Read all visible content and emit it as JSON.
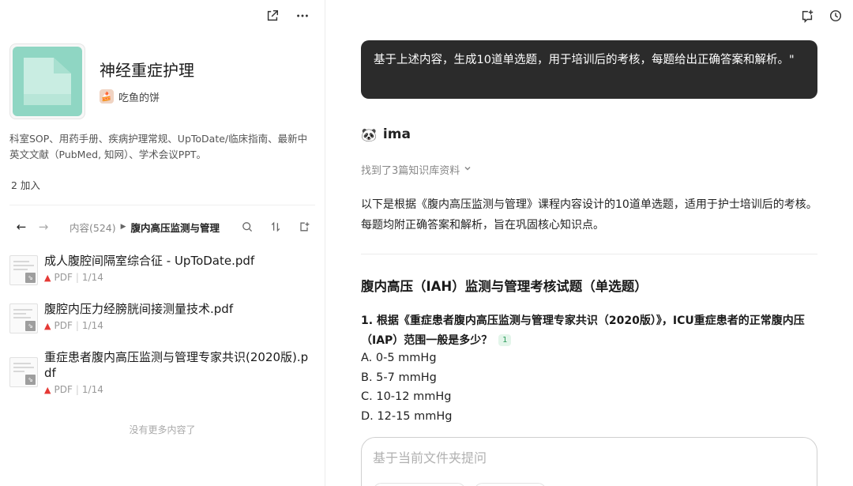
{
  "left_panel": {
    "knowledge_base": {
      "title": "神经重症护理",
      "author": "吃鱼的饼",
      "description": "科室SOP、用药手册、疾病护理常规、UpToDate/临床指南、最新中英文文献（PubMed, 知网）、学术会议PPT。",
      "joined": "2 加入"
    },
    "breadcrumb": {
      "root": "内容(524)",
      "current": "腹内高压监测与管理"
    },
    "files": [
      {
        "name": "成人腹腔间隔室综合征 - UpToDate.pdf",
        "type": "PDF",
        "pages": "1/14"
      },
      {
        "name": "腹腔内压力经膀胱间接测量技术.pdf",
        "type": "PDF",
        "pages": "1/14"
      },
      {
        "name": "重症患者腹内高压监测与管理专家共识(2020版).pdf",
        "type": "PDF",
        "pages": "1/14"
      }
    ],
    "no_more": "没有更多内容了"
  },
  "right_panel": {
    "user_message": "基于上述内容，生成10道单选题，用于培训后的考核，每题给出正确答案和解析。\"",
    "assistant_name": "ima",
    "found_sources": "找到了3篇知识库资料",
    "intro": "以下是根据《腹内高压监测与管理》课程内容设计的10道单选题，适用于护士培训后的考核。每题均附正确答案和解析，旨在巩固核心知识点。",
    "quiz_title": "腹内高压（IAH）监测与管理考核试题（单选题）",
    "question_1": {
      "text": "1. 根据《重症患者腹内高压监测与管理专家共识（2020版）》，ICU重症患者的正常腹内压（IAP）范围一般是多少？",
      "citation": "1",
      "options": [
        "A. 0-5 mmHg",
        "B. 5-7 mmHg",
        "C. 10-12 mmHg",
        "D. 12-15 mmHg"
      ]
    },
    "ask_placeholder": "基于当前文件夹提问"
  }
}
